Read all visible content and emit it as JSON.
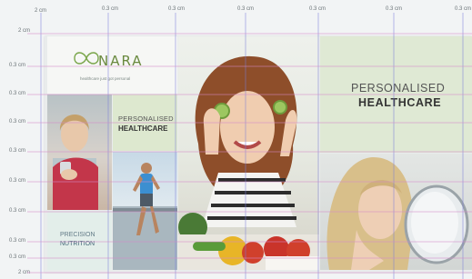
{
  "rulers": {
    "top": [
      "2 cm",
      "0.3 cm",
      "0.3 cm",
      "0.3 cm",
      "0.3 cm",
      "0.3 cm",
      "0.3 cm"
    ],
    "left": [
      "2 cm",
      "0.3 cm",
      "0.3 cm",
      "0.3 cm",
      "0.3 cm",
      "0.3 cm",
      "0.3 cm",
      "0.3 cm",
      "0.3 cm",
      "2 cm"
    ]
  },
  "logo": {
    "text": "NARA",
    "tagline": "healthcare just got personal"
  },
  "tiles": {
    "personalised_small": {
      "line1": "PERSONALISED",
      "line2": "HEALTHCARE"
    },
    "precision": {
      "line1": "PRECISION",
      "line2": "NUTRITION"
    },
    "personalised_big": {
      "line1": "PERSONALISED",
      "line2": "HEALTHCARE"
    }
  },
  "colors": {
    "brand_green": "#6a8a3f",
    "guide_blue": "#7a7cd8",
    "guide_pink": "#d58ac9"
  }
}
